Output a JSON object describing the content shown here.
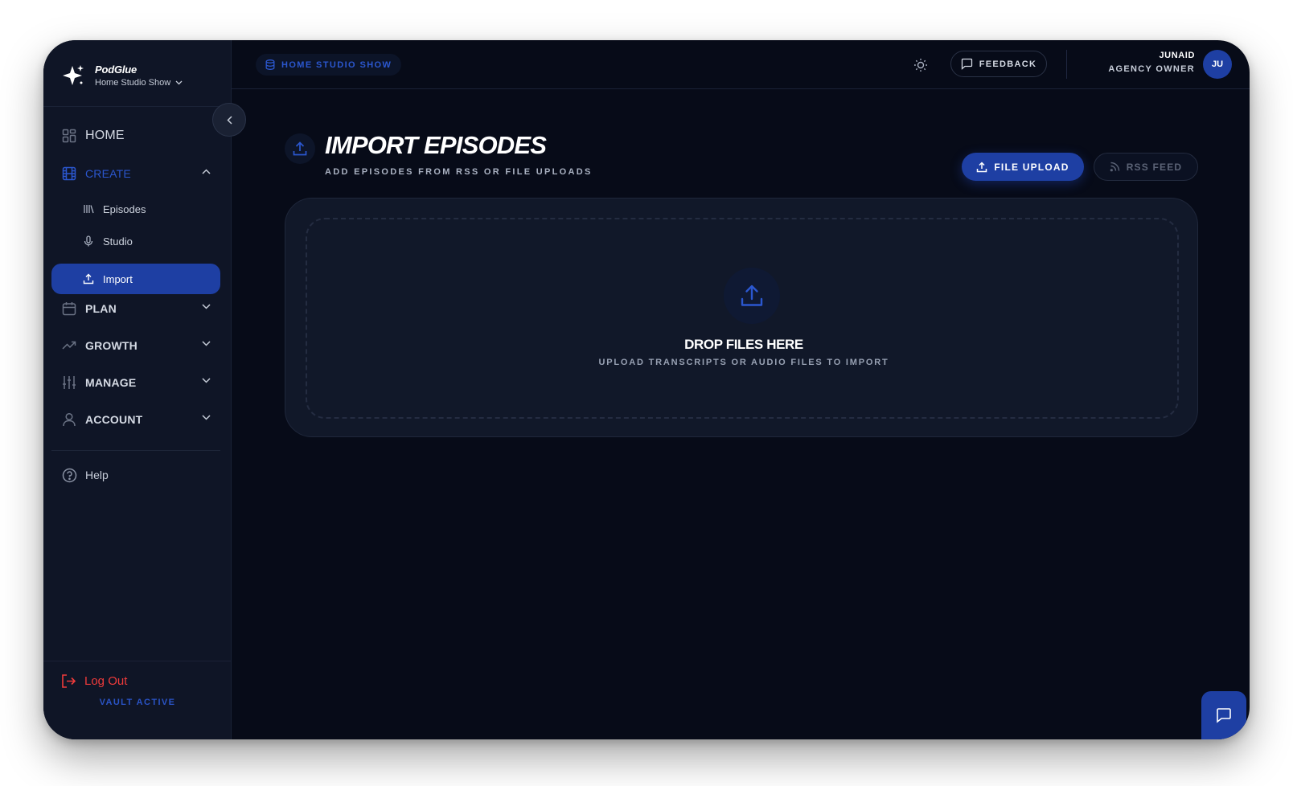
{
  "brand": {
    "name": "PodGlue",
    "show": "Home Studio Show"
  },
  "sidebar": {
    "items": [
      {
        "label": "HOME"
      },
      {
        "label": "CREATE"
      },
      {
        "label": "PLAN"
      },
      {
        "label": "GROWTH"
      },
      {
        "label": "MANAGE"
      },
      {
        "label": "ACCOUNT"
      }
    ],
    "create_subitems": [
      {
        "label": "Episodes"
      },
      {
        "label": "Studio"
      },
      {
        "label": "Import"
      }
    ],
    "help_label": "Help",
    "logout_label": "Log Out",
    "vault_status": "VAULT ACTIVE"
  },
  "header": {
    "show_pill": "HOME STUDIO SHOW",
    "feedback_label": "FEEDBACK",
    "user_name": "JUNAID",
    "user_role": "AGENCY OWNER",
    "avatar_initials": "JU"
  },
  "main": {
    "title": "IMPORT EPISODES",
    "subtitle": "ADD EPISODES FROM RSS OR FILE UPLOADS",
    "tabs": [
      {
        "label": "FILE UPLOAD",
        "active": true
      },
      {
        "label": "RSS FEED",
        "active": false
      }
    ],
    "dropzone": {
      "title": "DROP FILES HERE",
      "subtitle": "UPLOAD TRANSCRIPTS OR AUDIO FILES TO IMPORT"
    }
  },
  "icons": {
    "brand": "sparkle-icon",
    "home": "grid-icon",
    "create": "film-icon",
    "episodes": "library-icon",
    "studio": "microphone-icon",
    "import": "upload-icon",
    "plan": "calendar-icon",
    "growth": "trending-up-icon",
    "manage": "sliders-icon",
    "account": "user-icon",
    "help": "help-circle-icon",
    "logout": "logout-icon",
    "theme": "sun-icon",
    "feedback": "message-square-icon",
    "chat": "chat-icon"
  },
  "colors": {
    "background": "#070b18",
    "sidebar": "#0f1526",
    "accent": "#1e3fa3",
    "accent_text": "#2b57cf",
    "danger": "#ef3b3b"
  }
}
